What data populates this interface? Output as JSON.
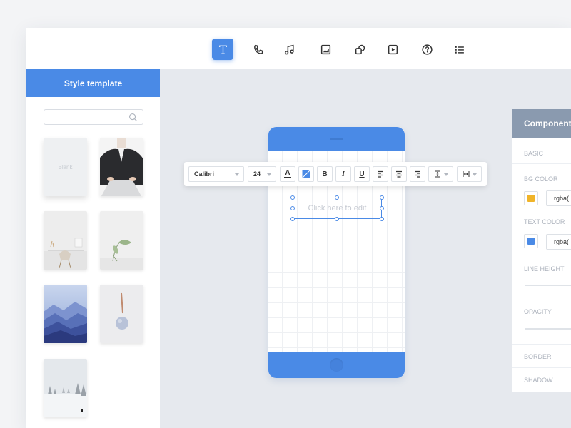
{
  "toolbar": {
    "tools": [
      {
        "icon": "text-icon",
        "active": true
      },
      {
        "icon": "phone-icon",
        "active": false
      },
      {
        "icon": "music-icon",
        "active": false
      },
      {
        "icon": "image-icon",
        "active": false
      },
      {
        "icon": "shapes-icon",
        "active": false
      },
      {
        "icon": "video-icon",
        "active": false
      },
      {
        "icon": "help-icon",
        "active": false
      },
      {
        "icon": "list-icon",
        "active": false
      }
    ]
  },
  "sidebar": {
    "title": "Style template",
    "search_placeholder": "",
    "templates": [
      {
        "label": "Blank",
        "kind": "blank"
      },
      {
        "label": "",
        "kind": "person-laptop"
      },
      {
        "label": "",
        "kind": "desk-chair"
      },
      {
        "label": "",
        "kind": "plant"
      },
      {
        "label": "",
        "kind": "mountains"
      },
      {
        "label": "",
        "kind": "pendant"
      },
      {
        "label": "",
        "kind": "snow-forest"
      }
    ]
  },
  "canvas": {
    "placeholder_text": "Click here to edit"
  },
  "format_bar": {
    "font": "Calibri",
    "size": "24",
    "font_color_label": "A",
    "bold": "B",
    "italic": "I",
    "underline": "U"
  },
  "properties": {
    "title": "Component",
    "basic": "BASIC",
    "bg_color": "BG COLOR",
    "bg_color_value": "rgba(",
    "text_color": "TEXT COLOR",
    "text_color_value": "rgba(",
    "line_height": "LINE HEIGHT",
    "opacity": "OPACITY",
    "border": "BORDER",
    "shadow": "SHADOW"
  },
  "colors": {
    "accent": "#4a8ae6",
    "bg_swatch": "#f0b429",
    "text_swatch": "#4a8ae6",
    "panel_header": "#8a9aaf"
  }
}
